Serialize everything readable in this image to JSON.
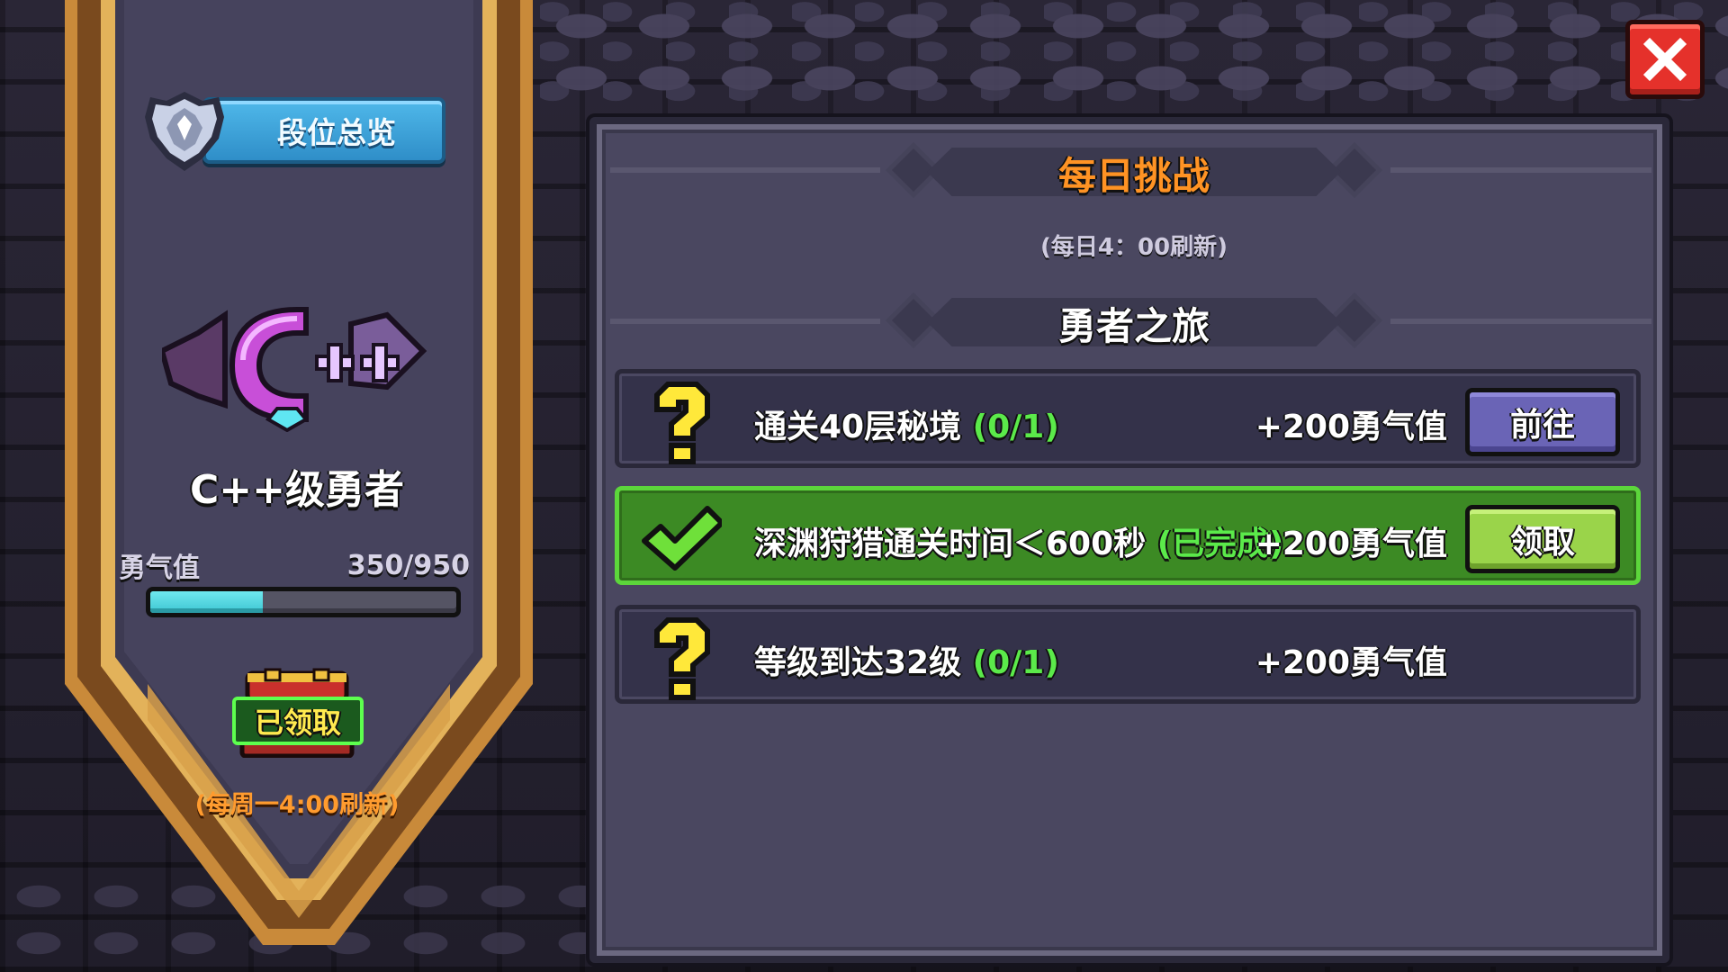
{
  "sidebar": {
    "rank_overview_label": "段位总览",
    "rank_badge_icon": "rank-badge-icon",
    "rank_emblem_icon": "cpp-rank-emblem",
    "rank_title": "C++级勇者",
    "courage_label": "勇气值",
    "courage_value": "350/950",
    "courage_progress": 0.368,
    "chest_status_label": "已领取",
    "weekly_refresh_note": "(每周一4:00刷新)"
  },
  "panel": {
    "daily_title": "每日挑战",
    "daily_refresh_note": "(每日4：00刷新)",
    "journey_title": "勇者之旅",
    "tasks": [
      {
        "icon": "question-mark-icon",
        "description": "通关40层秘境",
        "status": "(0/1)",
        "reward": "+200勇气值",
        "action": "前往",
        "completed": false
      },
      {
        "icon": "checkmark-icon",
        "description": "深渊狩猎通关时间＜600秒",
        "status": "(已完成)",
        "reward": "+200勇气值",
        "action": "领取",
        "completed": true
      },
      {
        "icon": "question-mark-icon",
        "description": "等级到达32级",
        "status": "(0/1)",
        "reward": "+200勇气值",
        "action": "",
        "completed": false
      }
    ]
  },
  "close_icon": "close-icon",
  "colors": {
    "accent_orange": "#ff9324",
    "status_green": "#5bea4a",
    "progress_cyan": "#4fd6df",
    "close_red": "#e5312b"
  }
}
